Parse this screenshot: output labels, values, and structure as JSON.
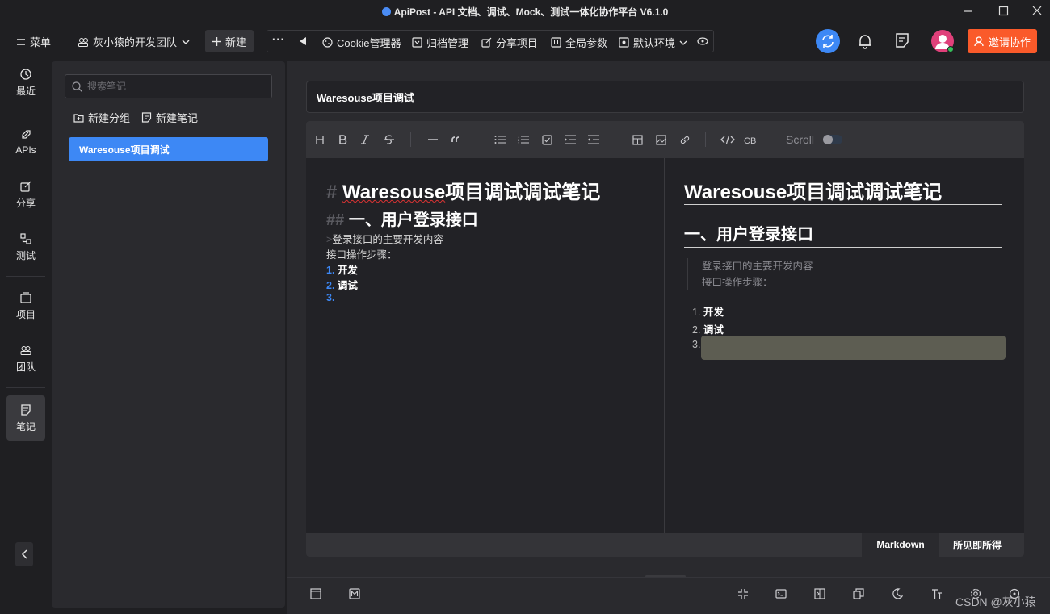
{
  "window": {
    "title": "ApiPost - API 文档、调试、Mock、测试一体化协作平台 V6.1.0"
  },
  "toolbar": {
    "menu_label": "菜单",
    "team_label": "灰小猿的开发团队",
    "new_label": "新建",
    "more_label": "···",
    "cookie_label": "Cookie管理器",
    "archive_label": "归档管理",
    "share_label": "分享项目",
    "global_params_label": "全局参数",
    "env_label": "默认环境",
    "invite_label": "邀请协作"
  },
  "rail": {
    "items": [
      {
        "label": "最近",
        "icon": "history-icon"
      },
      {
        "label": "APIs",
        "icon": "rocket-icon"
      },
      {
        "label": "分享",
        "icon": "share-icon"
      },
      {
        "label": "测试",
        "icon": "test-icon"
      },
      {
        "label": "项目",
        "icon": "project-icon"
      },
      {
        "label": "团队",
        "icon": "team-icon"
      },
      {
        "label": "笔记",
        "icon": "note-icon"
      }
    ],
    "active": "笔记"
  },
  "notes": {
    "search_placeholder": "搜索笔记",
    "new_group_label": "新建分组",
    "new_note_label": "新建笔记",
    "items": [
      {
        "title": "Waresouse项目调试",
        "selected": true
      }
    ]
  },
  "document": {
    "title": "Waresouse项目调试",
    "editor_toolbar": {
      "scroll_label": "Scroll"
    },
    "markdown": {
      "h1_hash": "#",
      "h1_word": "Waresouse",
      "h1_rest": "项目调试调试笔记",
      "h2_hash": "##",
      "h2_text": "一、用户登录接口",
      "quote_marker": ">",
      "quote_line1": "登录接口的主要开发内容",
      "line2": "接口操作步骤：",
      "list": [
        {
          "num": "1.",
          "text": "开发"
        },
        {
          "num": "2.",
          "text": "调试"
        },
        {
          "num": "3.",
          "text": ""
        }
      ]
    },
    "preview": {
      "h1": "Waresouse项目调试调试笔记",
      "h2": "一、用户登录接口",
      "quote_line1": "登录接口的主要开发内容",
      "quote_line2": "接口操作步骤：",
      "list": [
        {
          "num": "1.",
          "text": "开发"
        },
        {
          "num": "2.",
          "text": "调试"
        },
        {
          "num": "3.",
          "text": ""
        }
      ]
    },
    "modes": {
      "markdown_label": "Markdown",
      "wysiwyg_label": "所见即所得",
      "active": "Markdown"
    }
  },
  "watermark": "CSDN @灰小猿",
  "colors": {
    "accent": "#3d88f5",
    "invite": "#fa5a2a",
    "background": "#1f1f22",
    "panel": "#2a2a2e"
  }
}
